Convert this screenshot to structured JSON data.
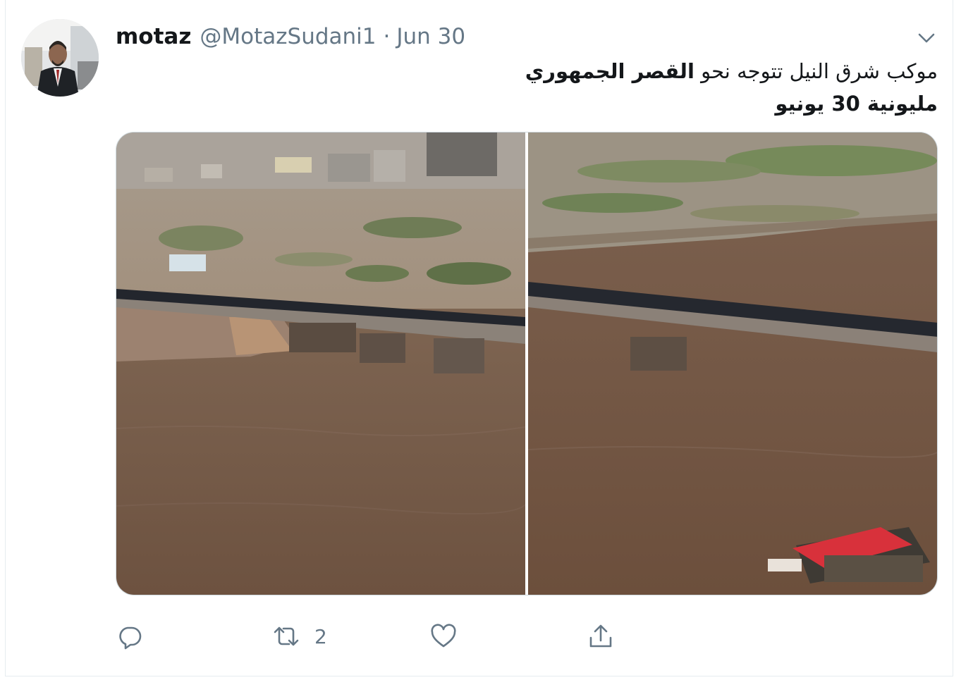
{
  "tweet": {
    "author": {
      "display_name": "motaz",
      "handle": "@MotazSudani1"
    },
    "separator": "·",
    "date": "Jun 30",
    "text": {
      "line1_regular": "موكب شرق النيل تتوجه نحو ",
      "line1_bold": "القصر الجمهوري",
      "line2_bold": "مليونية 30 يونيو"
    },
    "actions": {
      "reply_count": "",
      "retweet_count": "2",
      "like_count": "",
      "share_count": ""
    }
  },
  "icons": {
    "caret": "chevron-down-icon",
    "reply": "reply-icon",
    "retweet": "retweet-icon",
    "like": "heart-icon",
    "share": "share-icon"
  },
  "colors": {
    "text_primary": "#14171a",
    "text_secondary": "#657786",
    "border": "#e6ecf0",
    "river": "#7a5f4a"
  }
}
